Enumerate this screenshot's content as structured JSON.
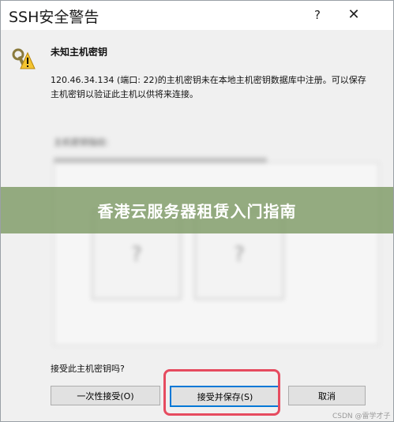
{
  "window": {
    "title": "SSH安全警告",
    "help_glyph": "?",
    "close_glyph": "✕"
  },
  "dialog": {
    "heading": "未知主机密钥",
    "message": "120.46.34.134 (端口: 22)的主机密钥未在本地主机密钥数据库中注册。可以保存主机密钥以验证此主机以供将来连接。",
    "fingerprint_label": "主机密钥指纹:",
    "fingerprint_box_left": "?",
    "fingerprint_box_right": "?",
    "question": "接受此主机密钥吗?",
    "icon": "warning-key-icon"
  },
  "buttons": {
    "accept_once": "一次性接受(O)",
    "accept_and_save": "接受并保存(S)",
    "cancel": "取消"
  },
  "overlay": {
    "banner_text": "香港云服务器租赁入门指南",
    "banner_color": "#78965f",
    "highlight_color": "#e64b5f"
  },
  "watermark": "CSDN @雷学才子"
}
